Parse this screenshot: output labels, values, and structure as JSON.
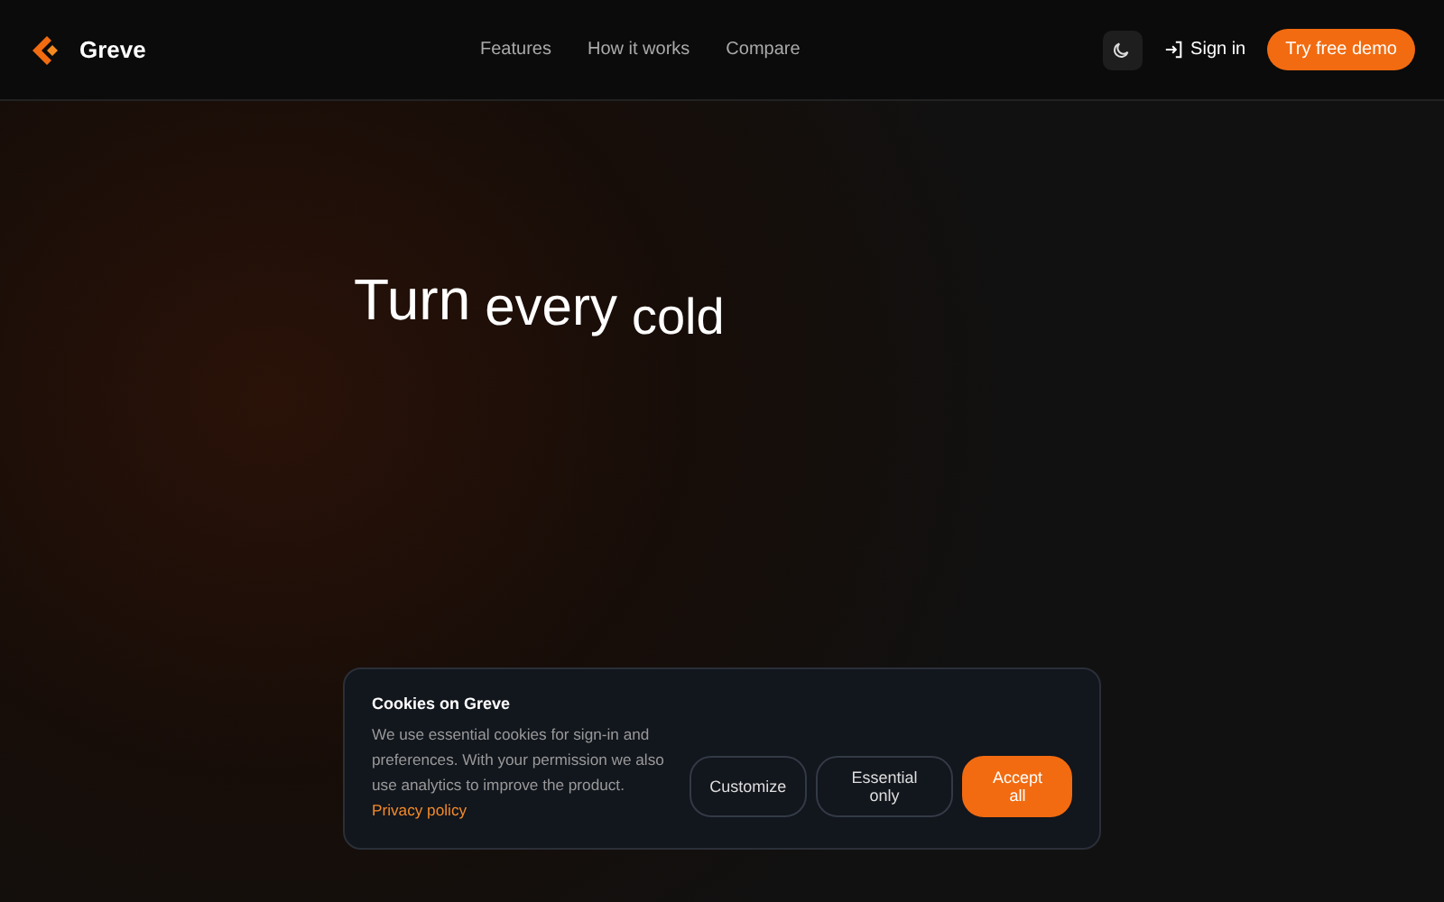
{
  "brand": {
    "name": "Greve"
  },
  "nav": [
    {
      "label": "Features"
    },
    {
      "label": "How it works"
    },
    {
      "label": "Compare"
    }
  ],
  "actions": {
    "sign_in": "Sign in",
    "demo": "Try free demo"
  },
  "hero": {
    "words": [
      "Turn",
      "every",
      "cold"
    ]
  },
  "cookie_banner": {
    "title": "Cookies on Greve",
    "text": "We use essential cookies for sign-in and preferences. With your permission we also use analytics to improve the product.",
    "link": "Privacy policy",
    "buttons": [
      {
        "label": "Customize",
        "kind": "outline"
      },
      {
        "label": "Essential only",
        "kind": "outline"
      },
      {
        "label": "Accept all",
        "kind": "primary"
      }
    ]
  }
}
